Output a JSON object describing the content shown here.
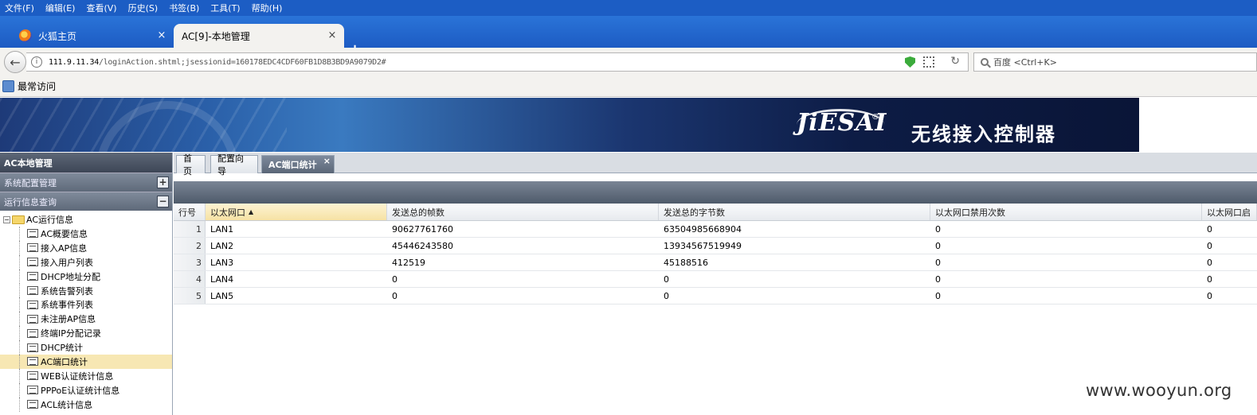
{
  "browser": {
    "menu": [
      "文件(F)",
      "编辑(E)",
      "查看(V)",
      "历史(S)",
      "书签(B)",
      "工具(T)",
      "帮助(H)"
    ],
    "tabs": [
      {
        "label": "火狐主页",
        "close": "×"
      },
      {
        "label": "AC[9]-本地管理",
        "close": "×"
      }
    ],
    "new_tab": "+",
    "url_host": "111.9.11.34",
    "url_path": "/loginAction.shtml;jsessionid=160178EDC4CDF60FB1D8B3BD9A9079D2#",
    "search_placeholder": "百度 <Ctrl+K>",
    "bookmark_label": "最常访问"
  },
  "banner": {
    "logo": "JiESAI",
    "registered": "®",
    "title": "无线接入控制器"
  },
  "sidebar": {
    "header": "AC本地管理",
    "sections": [
      {
        "label": "系统配置管理",
        "toggle": "+"
      },
      {
        "label": "运行信息查询",
        "toggle": "−"
      }
    ],
    "tree_root": "AC运行信息",
    "tree_items": [
      "AC概要信息",
      "接入AP信息",
      "接入用户列表",
      "DHCP地址分配",
      "系统告警列表",
      "系统事件列表",
      "未注册AP信息",
      "终端IP分配记录",
      "DHCP统计",
      "AC端口统计",
      "WEB认证统计信息",
      "PPPoE认证统计信息",
      "ACL统计信息"
    ],
    "active_item": "AC端口统计"
  },
  "content": {
    "tabs": [
      "首页",
      "配置向导",
      "AC端口统计"
    ],
    "tab_close": "×",
    "grid": {
      "headers": [
        "行号",
        "以太网口",
        "发送总的帧数",
        "发送总的字节数",
        "以太网口禁用次数",
        "以太网口启"
      ],
      "sort_arrow": "▲",
      "rows": [
        [
          "1",
          "LAN1",
          "90627761760",
          "63504985668904",
          "0",
          "0"
        ],
        [
          "2",
          "LAN2",
          "45446243580",
          "13934567519949",
          "0",
          "0"
        ],
        [
          "3",
          "LAN3",
          "412519",
          "45188516",
          "0",
          "0"
        ],
        [
          "4",
          "LAN4",
          "0",
          "0",
          "0",
          "0"
        ],
        [
          "5",
          "LAN5",
          "0",
          "0",
          "0",
          "0"
        ]
      ]
    }
  },
  "watermark": "www.wooyun.org"
}
